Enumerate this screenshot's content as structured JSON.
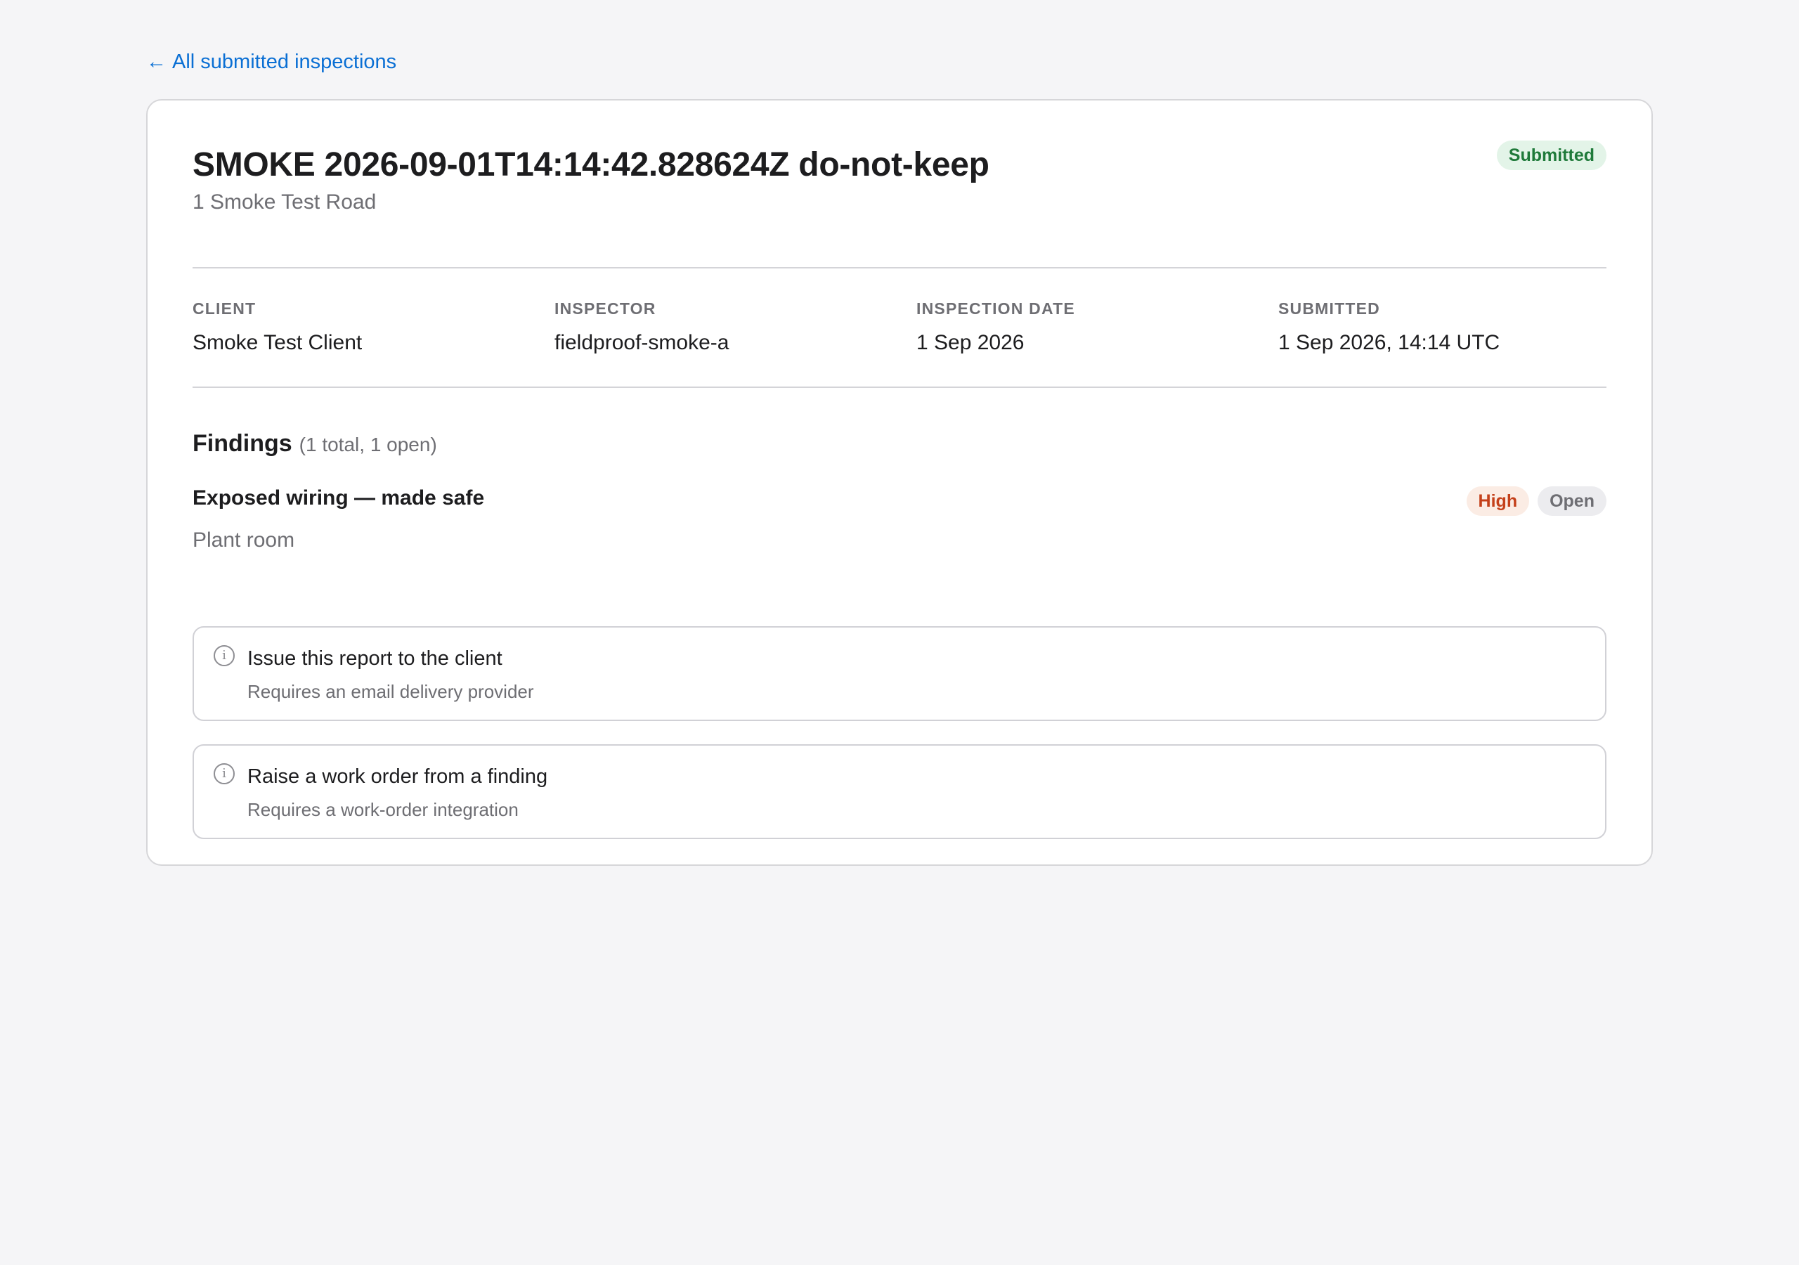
{
  "nav": {
    "back_arrow": "←",
    "back_label": "All submitted inspections"
  },
  "inspection": {
    "title": "SMOKE 2026-09-01T14:14:42.828624Z do-not-keep",
    "address": "1 Smoke Test Road",
    "status": "Submitted"
  },
  "meta": [
    {
      "label": "CLIENT",
      "value": "Smoke Test Client"
    },
    {
      "label": "INSPECTOR",
      "value": "fieldproof-smoke-a"
    },
    {
      "label": "INSPECTION DATE",
      "value": "1 Sep 2026"
    },
    {
      "label": "SUBMITTED",
      "value": "1 Sep 2026, 14:14 UTC"
    }
  ],
  "findings": {
    "title": "Findings",
    "count": "(1 total, 1 open)",
    "items": [
      {
        "title": "Exposed wiring — made safe",
        "location": "Plant room",
        "severity": "High",
        "status": "Open"
      }
    ]
  },
  "actions": [
    {
      "icon": "info-icon",
      "glyph": "i",
      "title": "Issue this report to the client",
      "subtitle": "Requires an email delivery provider"
    },
    {
      "icon": "info-icon",
      "glyph": "i",
      "title": "Raise a work order from a finding",
      "subtitle": "Requires a work-order integration"
    }
  ],
  "colors": {
    "link": "#0a6fd4",
    "submitted_bg": "#e3f4e8",
    "submitted_fg": "#1f7a3a",
    "high_bg": "#fbece4",
    "high_fg": "#c4401a",
    "open_bg": "#ececef",
    "open_fg": "#6e6e73"
  }
}
